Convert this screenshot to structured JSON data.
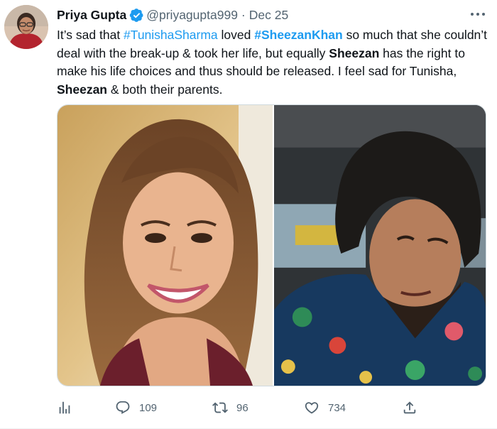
{
  "tweet": {
    "display_name": "Priya Gupta",
    "handle": "@priyagupta999",
    "separator": "·",
    "date": "Dec 25",
    "text": {
      "p1": "It’s sad that ",
      "tag1": "#TunishaSharma",
      "p2": " loved ",
      "tag2": "#SheezanKhan",
      "p3": " so much that she couldn’t deal with the break-up & took her life, but equally ",
      "name1": "Sheezan",
      "p4": " has the right to make his life choices and thus should be released. I feel sad for Tunisha, ",
      "name2": "Sheezan",
      "p5": " & both their parents."
    },
    "icons": {
      "verified": "verified-badge-icon",
      "more": "more-options-icon"
    }
  },
  "actions": {
    "analytics": {
      "icon": "analytics-icon"
    },
    "reply": {
      "icon": "reply-icon",
      "count": "109"
    },
    "retweet": {
      "icon": "retweet-icon",
      "count": "96"
    },
    "like": {
      "icon": "heart-icon",
      "count": "734"
    },
    "share": {
      "icon": "share-icon"
    }
  },
  "colors": {
    "link": "#1d9bf0",
    "secondary_text": "#536471",
    "primary_text": "#0f1419"
  }
}
